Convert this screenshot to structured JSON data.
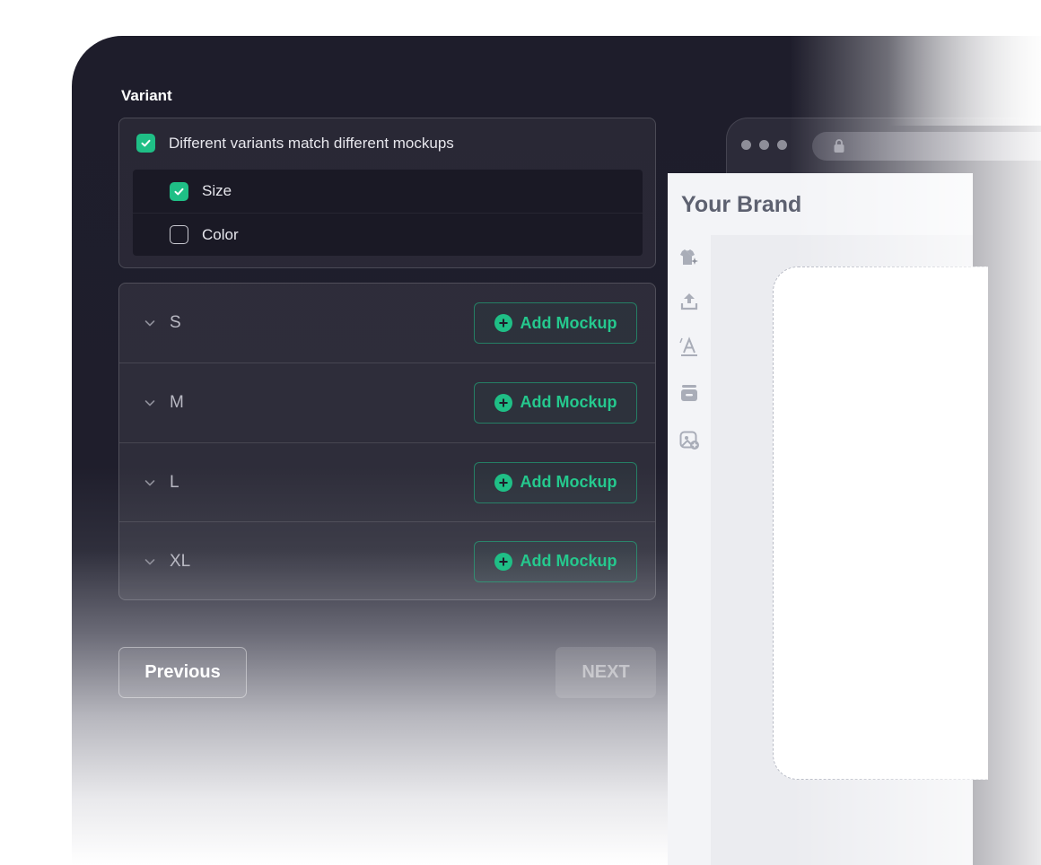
{
  "variant": {
    "section_label": "Variant",
    "main_option": {
      "label": "Different variants match different mockups",
      "checked": true
    },
    "sub_options": [
      {
        "label": "Size",
        "checked": true
      },
      {
        "label": "Color",
        "checked": false
      }
    ]
  },
  "sizes": [
    {
      "label": "S",
      "action_label": "Add Mockup"
    },
    {
      "label": "M",
      "action_label": "Add Mockup"
    },
    {
      "label": "L",
      "action_label": "Add Mockup"
    },
    {
      "label": "XL",
      "action_label": "Add Mockup"
    }
  ],
  "footer": {
    "previous_label": "Previous",
    "next_label": "NEXT"
  },
  "preview": {
    "brand_title": "Your Brand",
    "tools": [
      "tshirt-sparkle-icon",
      "upload-icon",
      "text-icon",
      "layer-icon",
      "image-add-icon"
    ]
  },
  "colors": {
    "accent": "#1fbf86",
    "background": "#1e1d2b",
    "panel_text": "#e6e6ec"
  }
}
